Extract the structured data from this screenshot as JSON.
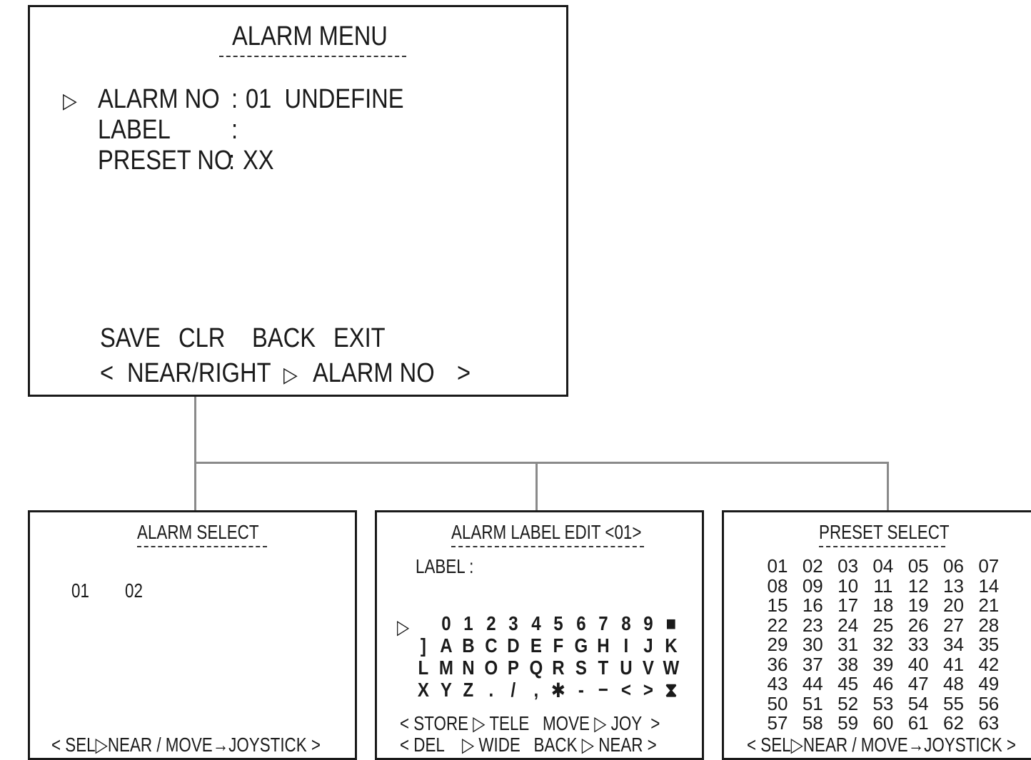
{
  "alarm_menu": {
    "title": "ALARM MENU",
    "cursor": "▷",
    "rows": [
      {
        "label": "ALARM NO",
        "sep": ":",
        "value": "01  UNDEFINE"
      },
      {
        "label": "LABEL",
        "sep": ":",
        "value": ""
      },
      {
        "label": "PRESET NO",
        "sep": ":",
        "value": "XX"
      }
    ],
    "actions": [
      "SAVE",
      "CLR",
      "BACK",
      "EXIT"
    ],
    "footer": {
      "open": "<",
      "left": "NEAR/RIGHT",
      "arrow": "▷",
      "right": "ALARM NO",
      "close": ">"
    }
  },
  "alarm_select": {
    "title": "ALARM SELECT",
    "items": [
      "01",
      "02"
    ],
    "footer": "< SEL▷NEAR / MOVE→JOYSTICK >"
  },
  "alarm_label_edit": {
    "title": "ALARM LABEL EDIT <01>",
    "label_text": "LABEL :",
    "cursor": "▷",
    "char_rows": [
      [
        "0",
        "1",
        "2",
        "3",
        "4",
        "5",
        "6",
        "7",
        "8",
        "9",
        "■"
      ],
      [
        "]",
        "A",
        "B",
        "C",
        "D",
        "E",
        "F",
        "G",
        "H",
        "I",
        "J",
        "K"
      ],
      [
        "L",
        "M",
        "N",
        "O",
        "P",
        "Q",
        "R",
        "S",
        "T",
        "U",
        "V",
        "W"
      ],
      [
        "X",
        "Y",
        "Z",
        ".",
        "/",
        ",",
        "✱",
        "-",
        "−",
        "<",
        ">",
        "⧗"
      ]
    ],
    "footer_line1": "< STORE ▷ TELE   MOVE ▷ JOY  >",
    "footer_line2": "< DEL    ▷ WIDE   BACK ▷ NEAR >"
  },
  "preset_select": {
    "title": "PRESET SELECT",
    "rows": [
      [
        "01",
        "02",
        "03",
        "04",
        "05",
        "06",
        "07"
      ],
      [
        "08",
        "09",
        "10",
        "11",
        "12",
        "13",
        "14"
      ],
      [
        "15",
        "16",
        "17",
        "18",
        "19",
        "20",
        "21"
      ],
      [
        "22",
        "23",
        "24",
        "25",
        "26",
        "27",
        "28"
      ],
      [
        "29",
        "30",
        "31",
        "32",
        "33",
        "34",
        "35"
      ],
      [
        "36",
        "37",
        "38",
        "39",
        "40",
        "41",
        "42"
      ],
      [
        "43",
        "44",
        "45",
        "46",
        "47",
        "48",
        "49"
      ],
      [
        "50",
        "51",
        "52",
        "53",
        "54",
        "55",
        "56"
      ],
      [
        "57",
        "58",
        "59",
        "60",
        "61",
        "62",
        "63"
      ]
    ],
    "footer": "< SEL▷NEAR / MOVE→JOYSTICK >"
  }
}
